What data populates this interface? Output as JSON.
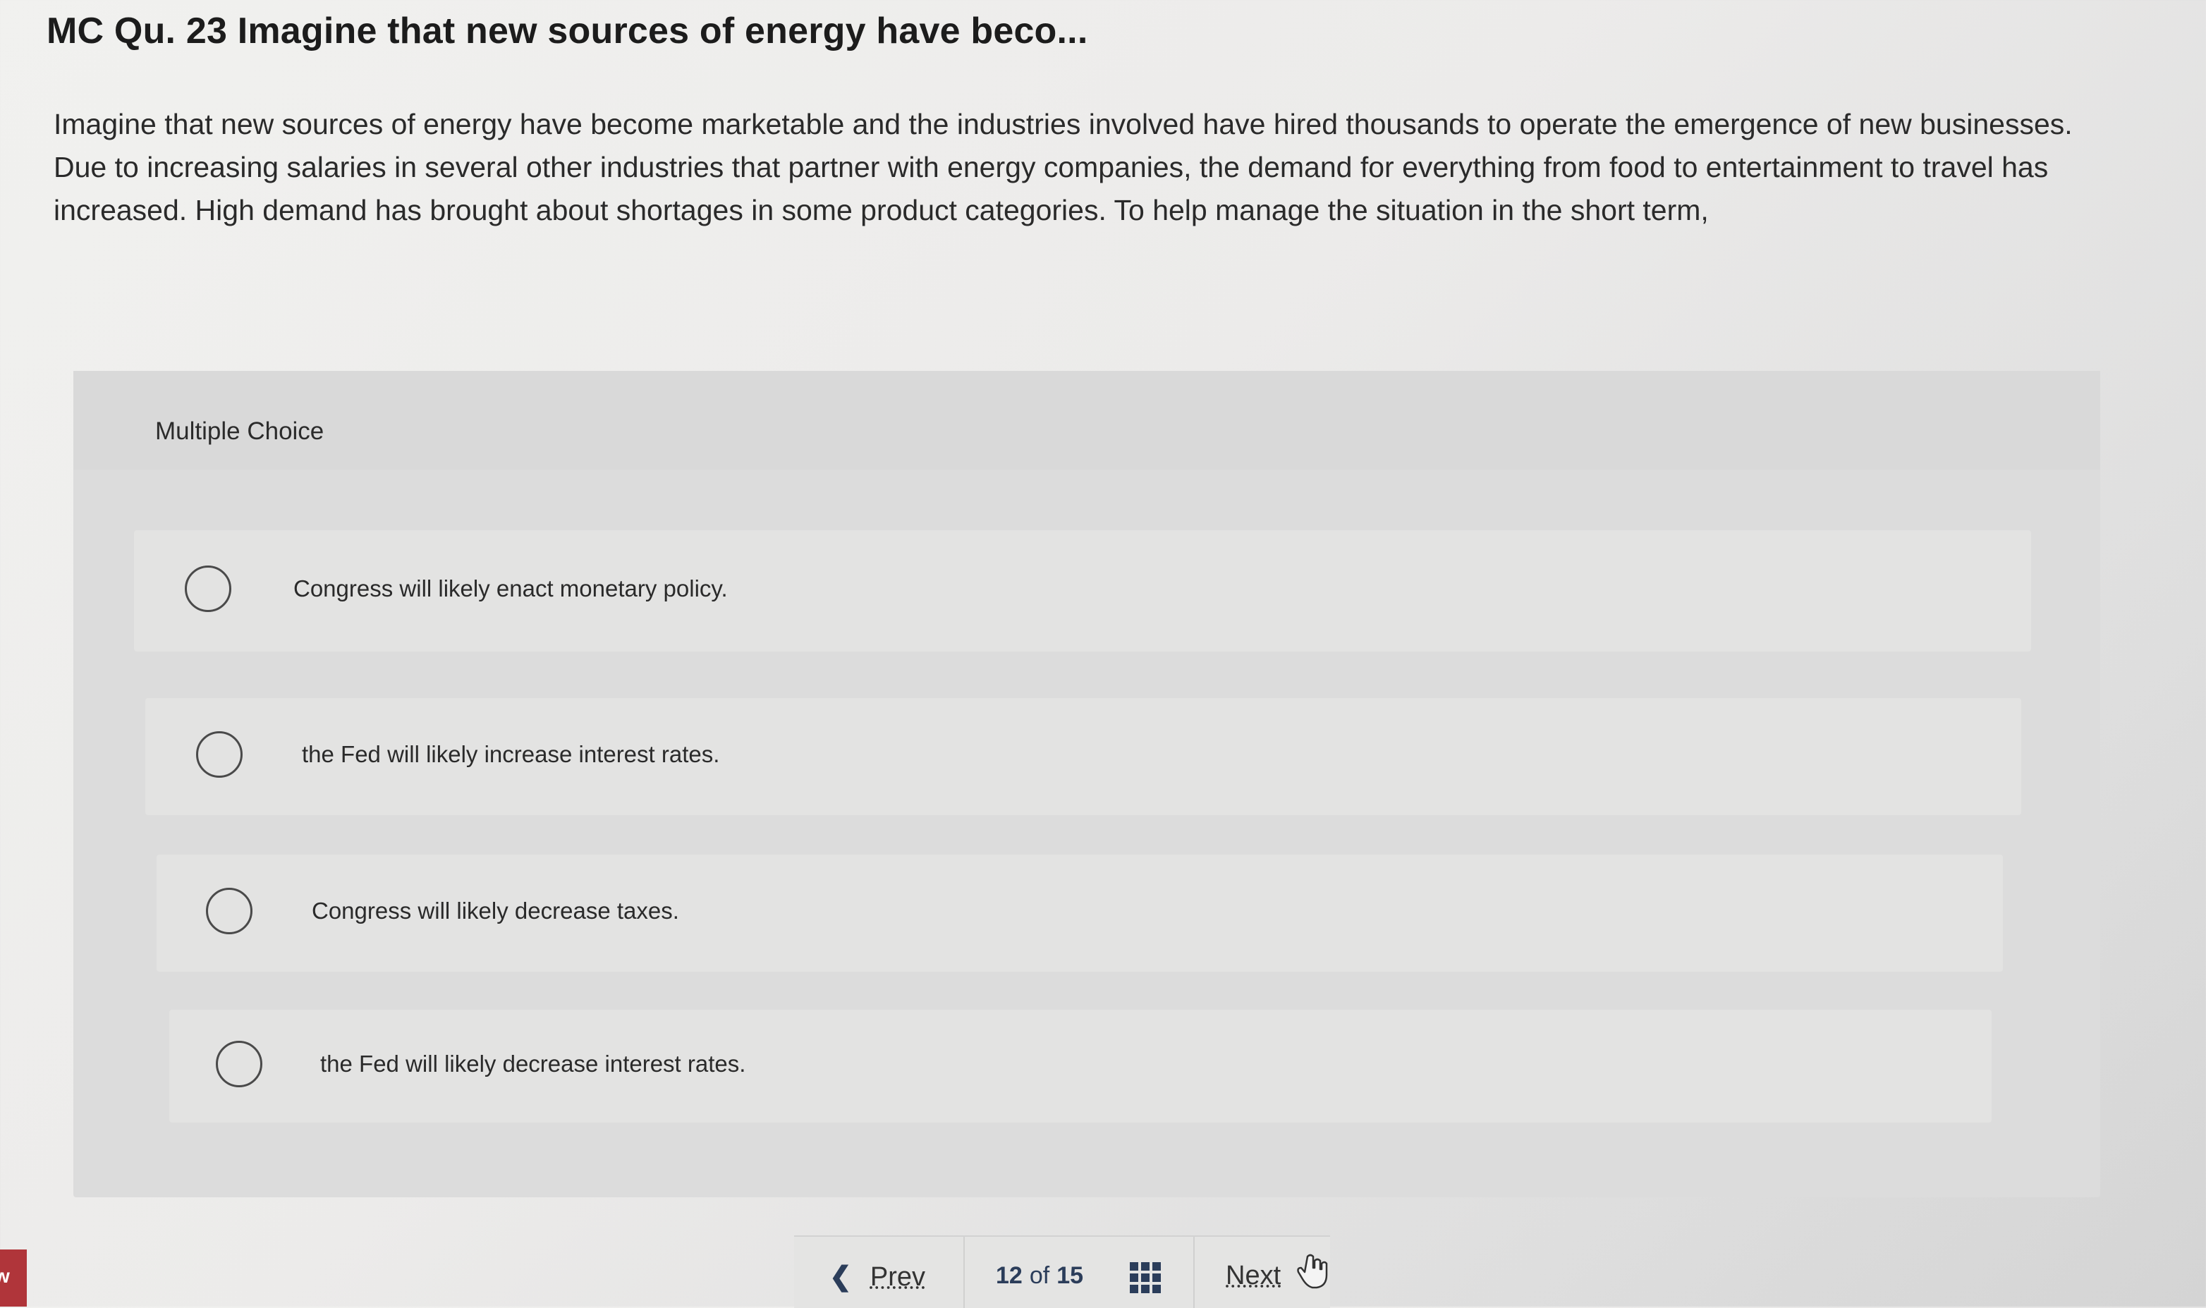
{
  "question": {
    "title": "MC Qu. 23 Imagine that new sources of energy have beco...",
    "body": "Imagine that new sources of energy have become marketable and the industries involved have hired thousands to operate the emergence of new businesses. Due to increasing salaries in several other industries that partner with energy companies, the demand for everything from food to entertainment to travel has increased. High demand has brought about shortages in some product categories. To help manage the situation in the short term,"
  },
  "multiple_choice": {
    "label": "Multiple Choice",
    "choices": [
      {
        "text": "Congress will likely enact monetary policy."
      },
      {
        "text": "the Fed will likely increase interest rates."
      },
      {
        "text": "Congress will likely decrease taxes."
      },
      {
        "text": "the Fed will likely decrease interest rates."
      }
    ]
  },
  "navigation": {
    "prev_label": "Prev",
    "current_page": "12",
    "of_label": "of",
    "total_pages": "15",
    "next_label": "Next"
  },
  "side_badge": {
    "text": "w"
  },
  "colors": {
    "accent": "#2b3d5a",
    "badge": "#b0353a"
  }
}
